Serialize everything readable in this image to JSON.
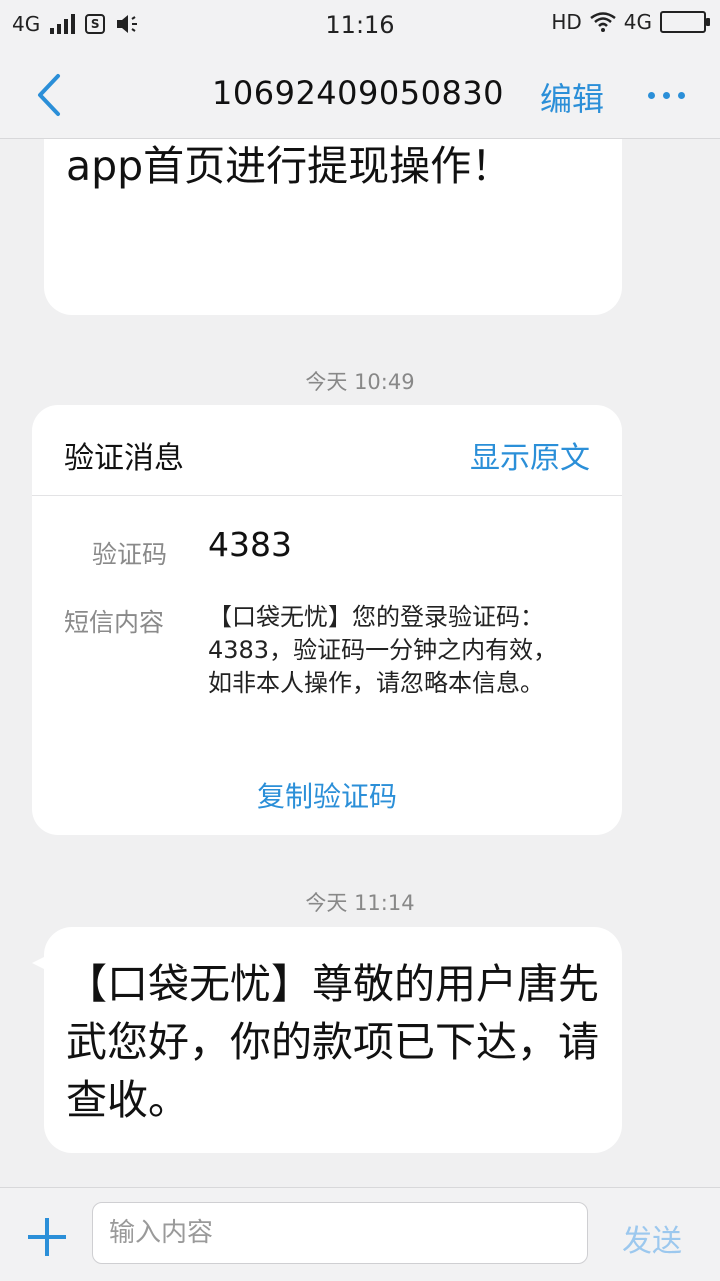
{
  "status_bar": {
    "network": "4G",
    "time": "11:16",
    "hd": "HD",
    "network_right": "4G",
    "sim_icon_label": "S"
  },
  "nav": {
    "title": "10692409050830",
    "edit": "编辑"
  },
  "messages": {
    "first_text": "的授信审核已通过，马上登录app首页进行提现操作！",
    "time1": "今天 10:49",
    "card": {
      "title": "验证消息",
      "show_original": "显示原文",
      "code_label": "验证码",
      "code_value": "4383",
      "content_label": "短信内容",
      "content_text": "【口袋无忧】您的登录验证码：4383，验证码一分钟之内有效，如非本人操作，请忽略本信息。",
      "copy_button": "复制验证码"
    },
    "time2": "今天 11:14",
    "second_text": "【口袋无忧】尊敬的用户唐先武您好，你的款项已下达，请查收。"
  },
  "input_bar": {
    "placeholder": "输入内容",
    "value": "",
    "send": "发送"
  },
  "colors": {
    "accent": "#2b8fd8",
    "background": "#f0f0f1",
    "send_disabled": "#9cc8ee"
  }
}
